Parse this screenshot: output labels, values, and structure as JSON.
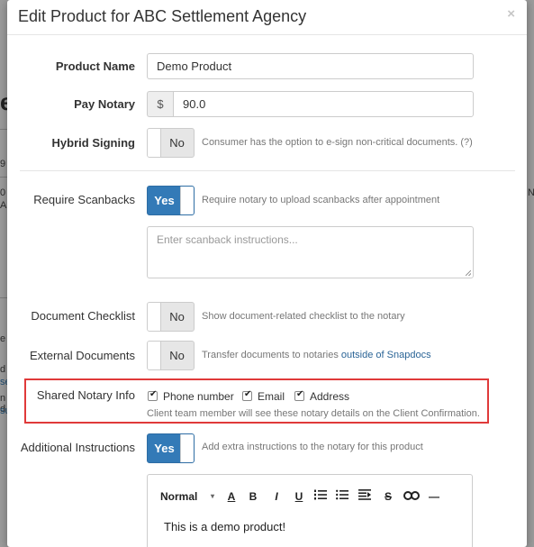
{
  "modal": {
    "title": "Edit Product for ABC Settlement Agency",
    "close_label": "×"
  },
  "background": {
    "fragments": [
      "e",
      "9",
      "0",
      "A",
      "e",
      "d",
      "se",
      "n",
      "d",
      "su"
    ],
    "right_fragment": "N"
  },
  "fields": {
    "product_name": {
      "label": "Product Name",
      "value": "Demo Product"
    },
    "pay_notary": {
      "label": "Pay Notary",
      "currency_symbol": "$",
      "value": "90.0"
    },
    "hybrid_signing": {
      "label": "Hybrid Signing",
      "toggle_value": "No",
      "help": "Consumer has the option to e-sign non-critical documents. (?)"
    },
    "require_scanbacks": {
      "label": "Require Scanbacks",
      "toggle_value": "Yes",
      "help": "Require notary to upload scanbacks after appointment",
      "placeholder": "Enter scanback instructions..."
    },
    "document_checklist": {
      "label": "Document Checklist",
      "toggle_value": "No",
      "help": "Show document-related checklist to the notary"
    },
    "external_documents": {
      "label": "External Documents",
      "toggle_value": "No",
      "help_prefix": "Transfer documents to notaries ",
      "help_link": "outside of Snapdocs"
    },
    "shared_notary_info": {
      "label": "Shared Notary Info",
      "options": [
        {
          "label": "Phone number",
          "checked": true
        },
        {
          "label": "Email",
          "checked": true
        },
        {
          "label": "Address",
          "checked": true
        }
      ],
      "help": "Client team member will see these notary details on the Client Confirmation."
    },
    "additional_instructions": {
      "label": "Additional Instructions",
      "toggle_value": "Yes",
      "help": "Add extra instructions to the notary for this product"
    }
  },
  "editor": {
    "format_select": "Normal",
    "tools": [
      "font-color",
      "bold",
      "italic",
      "underline",
      "ordered-list",
      "bullet-list",
      "indent",
      "strikethrough",
      "link",
      "horizontal-rule"
    ],
    "tool_glyphs": {
      "font_color": "A",
      "bold": "B",
      "italic": "I",
      "underline": "U",
      "strike": "S",
      "hr": "—"
    },
    "content": "This is a demo product!"
  },
  "colors": {
    "primary": "#337ab7",
    "highlight": "#e03a3a"
  }
}
